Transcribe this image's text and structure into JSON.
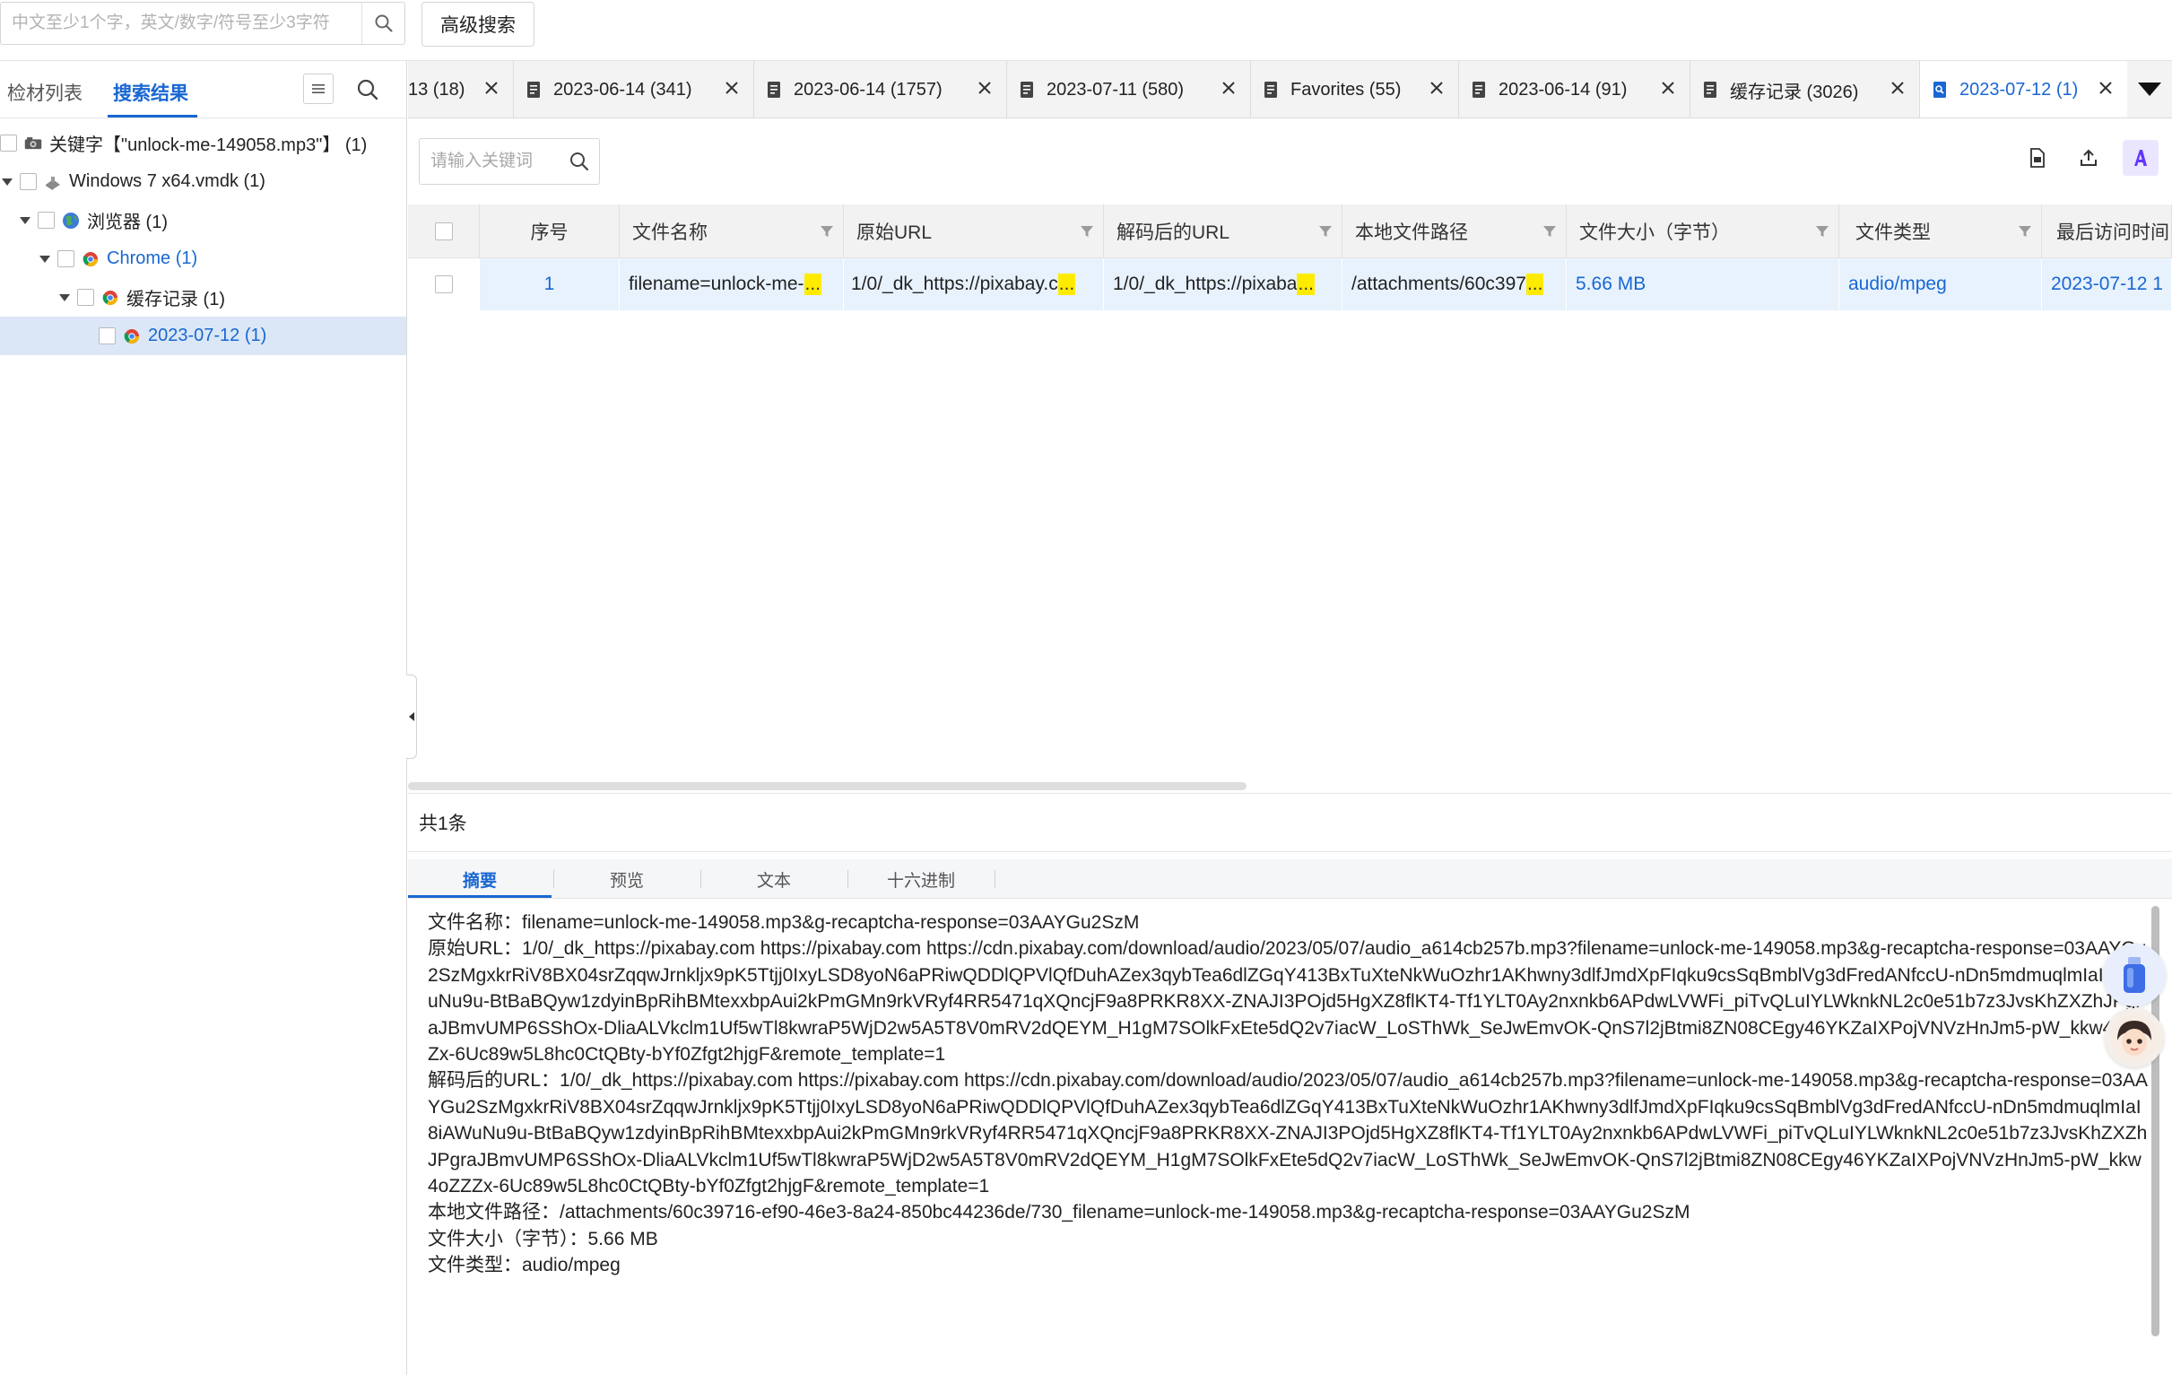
{
  "top": {
    "search_placeholder": "中文至少1个字，英文/数字/符号至少3字符",
    "advanced_search_label": "高级搜索"
  },
  "left": {
    "tab_material_list": "检材列表",
    "tab_search_results": "搜索结果",
    "tree": [
      {
        "label": "关键字【\"unlock-me-149058.mp3\"】 (1)",
        "icon": "keyword-icon"
      },
      {
        "label": "Windows 7 x64.vmdk (1)",
        "icon": "disk-icon"
      },
      {
        "label": "浏览器 (1)",
        "icon": "browser-globe-icon"
      },
      {
        "label": "Chrome (1)",
        "icon": "chrome-icon"
      },
      {
        "label": "缓存记录 (1)",
        "icon": "chrome-icon"
      },
      {
        "label": "2023-07-12 (1)",
        "icon": "chrome-icon"
      }
    ]
  },
  "tabs": [
    {
      "label": "13 (18)"
    },
    {
      "label": "2023-06-14 (341)"
    },
    {
      "label": "2023-06-14 (1757)"
    },
    {
      "label": "2023-07-11 (580)"
    },
    {
      "label": "Favorites (55)"
    },
    {
      "label": "2023-06-14 (91)"
    },
    {
      "label": "缓存记录 (3026)"
    },
    {
      "label": "2023-07-12 (1)"
    }
  ],
  "main": {
    "keyword_placeholder": "请输入关键词",
    "columns": {
      "index": "序号",
      "filename": "文件名称",
      "original_url": "原始URL",
      "decoded_url": "解码后的URL",
      "local_path": "本地文件路径",
      "file_size": "文件大小（字节）",
      "file_type": "文件类型",
      "last_access": "最后访问时间"
    },
    "row": {
      "index": "1",
      "filename": "filename=unlock-me-",
      "original_url": "1/0/_dk_https://pixabay.c",
      "decoded_url": "1/0/_dk_https://pixaba",
      "local_path": "/attachments/60c397",
      "file_size": "5.66 MB",
      "file_type": "audio/mpeg",
      "last_access": "2023-07-12 1",
      "ellipsis": "..."
    },
    "count_text": "共1条"
  },
  "detail": {
    "tabs": [
      "摘要",
      "预览",
      "文本",
      "十六进制"
    ],
    "lines": [
      "文件名称：filename=unlock-me-149058.mp3&g-recaptcha-response=03AAYGu2SzM",
      "原始URL：1/0/_dk_https://pixabay.com https://pixabay.com https://cdn.pixabay.com/download/audio/2023/05/07/audio_a614cb257b.mp3?filename=unlock-me-149058.mp3&g-recaptcha-response=03AAYGu2SzMgxkrRiV8BX04srZqqwJrnkljx9pK5Ttjj0IxyLSD8yoN6aPRiwQDDlQPVlQfDuhAZex3qybTea6dlZGqY413BxTuXteNkWuOzhr1AKhwny3dlfJmdXpFIqku9csSqBmblVg3dFredANfccU-nDn5mdmuqlmIaI8iAWuNu9u-BtBaBQyw1zdyinBpRihBMtexxbpAui2kPmGMn9rkVRyf4RR5471qXQncjF9a8PRKR8XX-ZNAJI3POjd5HgXZ8flKT4-Tf1YLT0Ay2nxnkb6APdwLVWFi_piTvQLuIYLWknkNL2c0e51b7z3JvsKhZXZhJPgraJBmvUMP6SShOx-DliaALVkclm1Uf5wTl8kwraP5WjD2w5A5T8V0mRV2dQEYM_H1gM7SOlkFxEte5dQ2v7iacW_LoSThWk_SeJwEmvOK-QnS7l2jBtmi8ZN08CEgy46YKZaIXPojVNVzHnJm5-pW_kkw4oZZZx-6Uc89w5L8hc0CtQBty-bYf0Zfgt2hjgF&remote_template=1",
      "解码后的URL：1/0/_dk_https://pixabay.com https://pixabay.com https://cdn.pixabay.com/download/audio/2023/05/07/audio_a614cb257b.mp3?filename=unlock-me-149058.mp3&g-recaptcha-response=03AAYGu2SzMgxkrRiV8BX04srZqqwJrnkljx9pK5Ttjj0IxyLSD8yoN6aPRiwQDDlQPVlQfDuhAZex3qybTea6dlZGqY413BxTuXteNkWuOzhr1AKhwny3dlfJmdXpFIqku9csSqBmblVg3dFredANfccU-nDn5mdmuqlmIaI8iAWuNu9u-BtBaBQyw1zdyinBpRihBMtexxbpAui2kPmGMn9rkVRyf4RR5471qXQncjF9a8PRKR8XX-ZNAJI3POjd5HgXZ8flKT4-Tf1YLT0Ay2nxnkb6APdwLVWFi_piTvQLuIYLWknkNL2c0e51b7z3JvsKhZXZhJPgraJBmvUMP6SShOx-DliaALVkclm1Uf5wTl8kwraP5WjD2w5A5T8V0mRV2dQEYM_H1gM7SOlkFxEte5dQ2v7iacW_LoSThWk_SeJwEmvOK-QnS7l2jBtmi8ZN08CEgy46YKZaIXPojVNVzHnJm5-pW_kkw4oZZZx-6Uc89w5L8hc0CtQBty-bYf0Zfgt2hjgF&remote_template=1",
      "本地文件路径：/attachments/60c39716-ef90-46e3-8a24-850bc44236de/730_filename=unlock-me-149058.mp3&g-recaptcha-response=03AAYGu2SzM",
      "文件大小（字节）：5.66 MB",
      "文件类型：audio/mpeg"
    ]
  },
  "colors": {
    "accent": "#1967d2",
    "row_highlight": "#e8f2fd",
    "ellipsis_highlight": "#ffeb00"
  }
}
